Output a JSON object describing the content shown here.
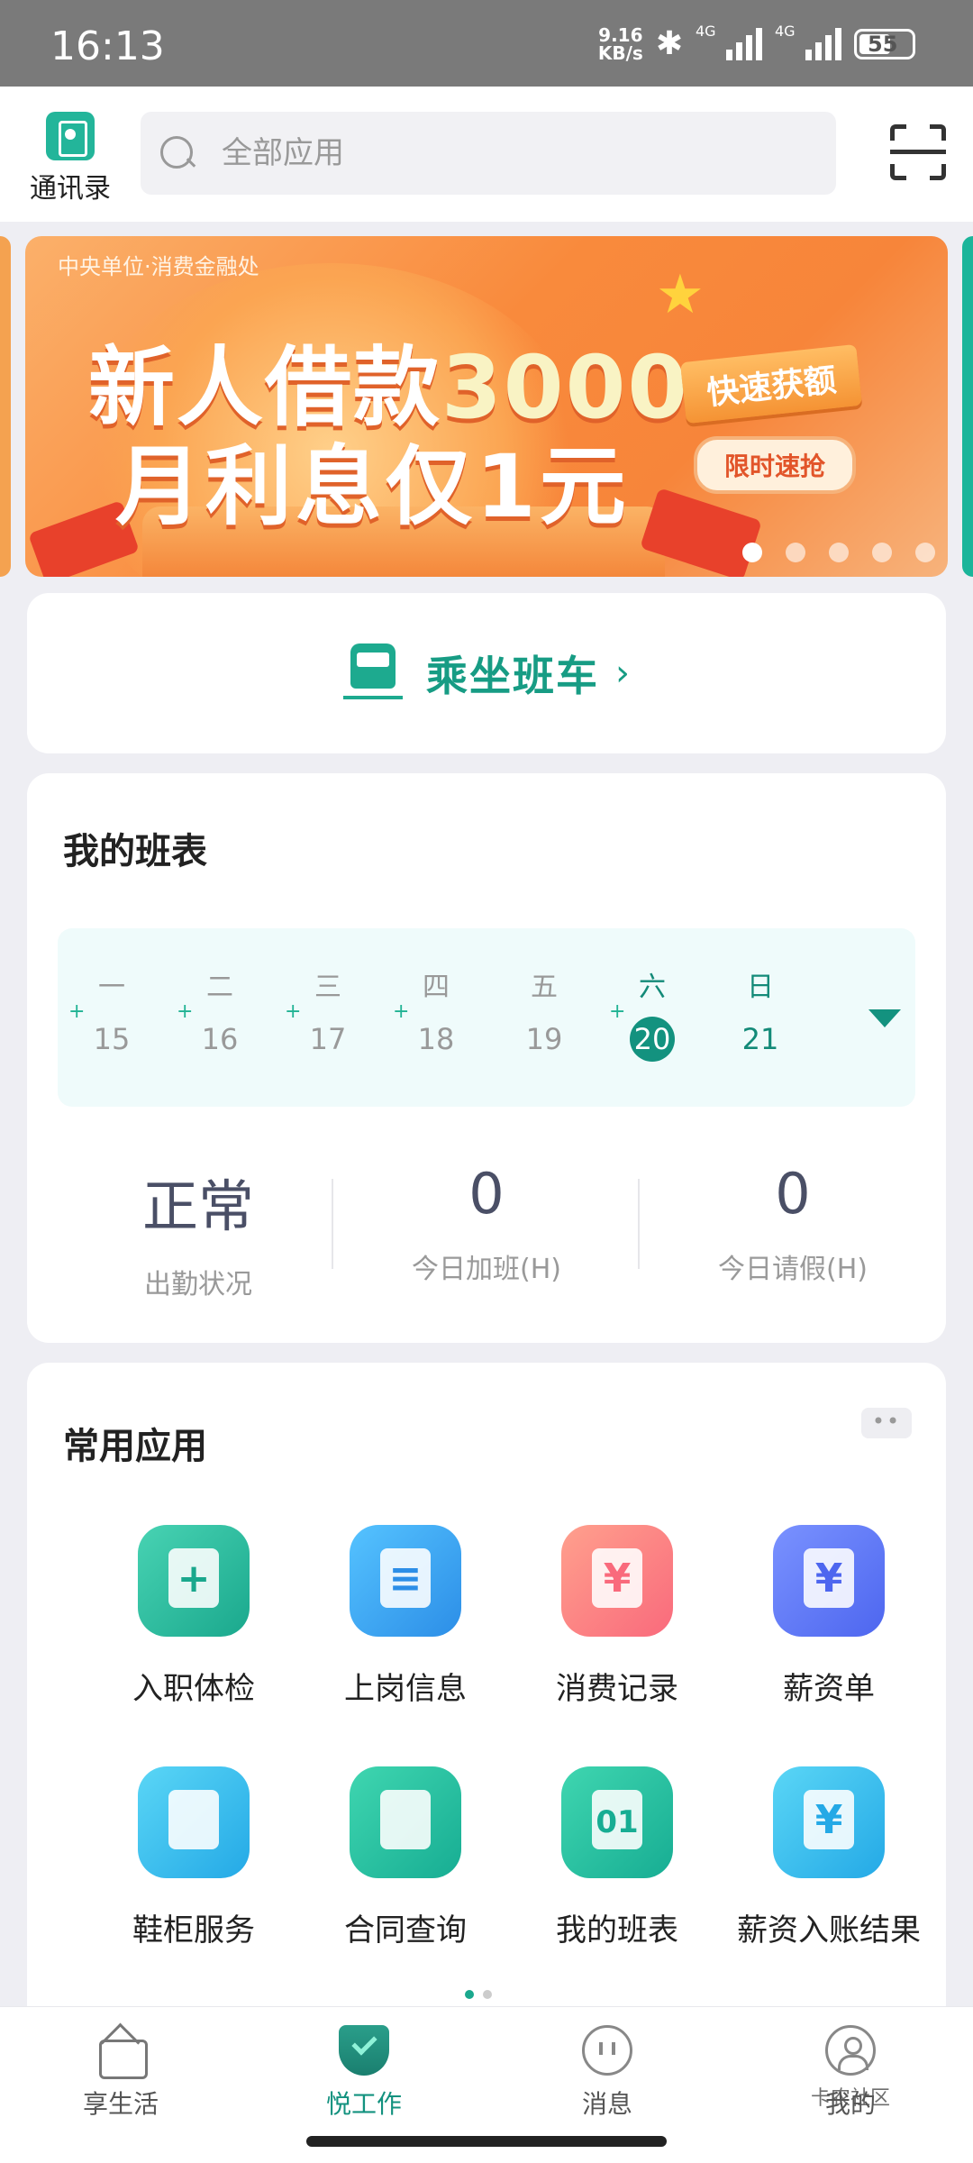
{
  "status_bar": {
    "time": "16:13",
    "net_speed_value": "9.16",
    "net_speed_unit": "KB/s",
    "signal1": "4G",
    "signal2": "4G",
    "battery": "55"
  },
  "header": {
    "contacts_label": "通讯录",
    "search_placeholder": "全部应用"
  },
  "banner": {
    "subtitle": "中央单位·消费金融处",
    "line1_text": "新人借款",
    "line1_amount": "3000",
    "line2": "月利息仅1元",
    "tag1": "快速获额",
    "tag2": "限时速抢",
    "dots": 5,
    "active_dot": 0
  },
  "shuttle": {
    "label": "乘坐班车"
  },
  "schedule": {
    "title": "我的班表",
    "days": [
      {
        "weekday": "一",
        "date": "15",
        "mark": "+"
      },
      {
        "weekday": "二",
        "date": "16",
        "mark": "+"
      },
      {
        "weekday": "三",
        "date": "17",
        "mark": "+"
      },
      {
        "weekday": "四",
        "date": "18",
        "mark": "+"
      },
      {
        "weekday": "五",
        "date": "19",
        "mark": ""
      },
      {
        "weekday": "六",
        "date": "20",
        "mark": "+"
      },
      {
        "weekday": "日",
        "date": "21",
        "mark": ""
      }
    ],
    "stats": [
      {
        "value": "正常",
        "label": "出勤状况"
      },
      {
        "value": "0",
        "label": "今日加班(H)"
      },
      {
        "value": "0",
        "label": "今日请假(H)"
      }
    ]
  },
  "apps": {
    "title": "常用应用",
    "more": "••",
    "items": [
      {
        "label": "入职体检",
        "glyph": "+"
      },
      {
        "label": "上岗信息",
        "glyph": "≡"
      },
      {
        "label": "消费记录",
        "glyph": "¥"
      },
      {
        "label": "薪资单",
        "glyph": "¥"
      },
      {
        "label": "鞋柜服务",
        "glyph": ""
      },
      {
        "label": "合同查询",
        "glyph": ""
      },
      {
        "label": "我的班表",
        "glyph": "01"
      },
      {
        "label": "薪资入账结果",
        "glyph": "¥"
      }
    ]
  },
  "bottom_nav": [
    {
      "label": "享生活"
    },
    {
      "label": "悦工作"
    },
    {
      "label": "消息"
    },
    {
      "label": "我的"
    }
  ],
  "watermark_brand": "卡农社区"
}
